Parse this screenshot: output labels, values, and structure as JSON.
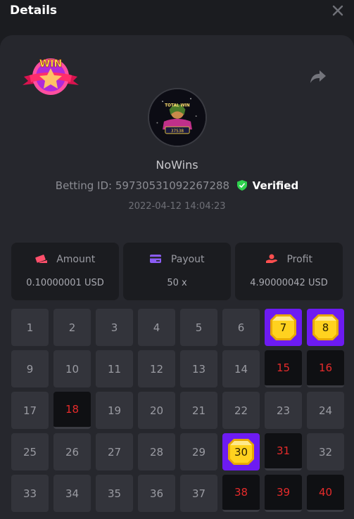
{
  "header": {
    "title": "Details",
    "close_icon": "close-icon"
  },
  "bet": {
    "username": "NoWins",
    "betting_id_label": "Betting ID:",
    "betting_id": "59730531092267288",
    "verified_label": "Verified",
    "datetime": "2022-04-12 14:04:23",
    "badge_text": "WIN",
    "avatar_caption": "TOTAL WIN"
  },
  "stats": [
    {
      "label": "Amount",
      "value": "0.10000001 USD",
      "icon": "money-icon",
      "icon_color": "#ff4f6b"
    },
    {
      "label": "Payout",
      "value": "50 x",
      "icon": "card-icon",
      "icon_color": "#8b5cf6"
    },
    {
      "label": "Profit",
      "value": "4.90000042 USD",
      "icon": "profit-hand-icon",
      "icon_color": "#ff4f4f"
    }
  ],
  "board": {
    "numbers": [
      "1",
      "2",
      "3",
      "4",
      "5",
      "6",
      "7",
      "8",
      "9",
      "10",
      "11",
      "12",
      "13",
      "14",
      "15",
      "16",
      "17",
      "18",
      "19",
      "20",
      "21",
      "22",
      "23",
      "24",
      "25",
      "26",
      "27",
      "28",
      "29",
      "30",
      "31",
      "32",
      "33",
      "34",
      "35",
      "36",
      "37",
      "38",
      "39",
      "40"
    ],
    "picked_hits": [
      "7",
      "8",
      "30"
    ],
    "drawn_misses": [
      "15",
      "16",
      "18",
      "31",
      "38",
      "39",
      "40"
    ]
  },
  "colors": {
    "accent": "#6d1bf2",
    "hit_text": "#e62b2b",
    "verified": "#2fd14e",
    "gem": "#ffd21f"
  }
}
